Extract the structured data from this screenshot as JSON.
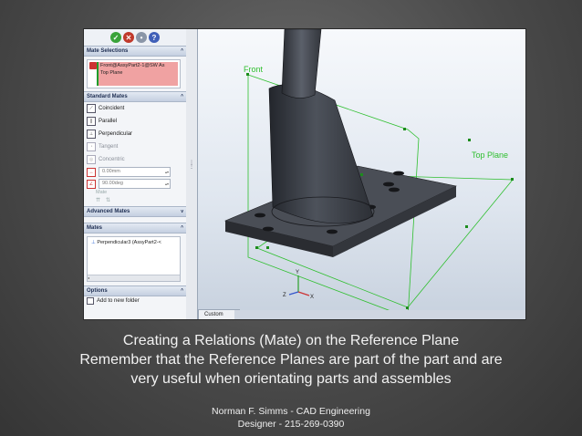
{
  "property_manager": {
    "mate_selections": {
      "title": "Mate Selections",
      "items": [
        "Front@AssyPart2-1@SW As",
        "Top Plane"
      ]
    },
    "standard_mates": {
      "title": "Standard Mates",
      "options": [
        {
          "label": "Coincident",
          "icon": "coincident-icon"
        },
        {
          "label": "Parallel",
          "icon": "parallel-icon"
        },
        {
          "label": "Perpendicular",
          "icon": "perpendicular-icon"
        },
        {
          "label": "Tangent",
          "icon": "tangent-icon"
        },
        {
          "label": "Concentric",
          "icon": "concentric-icon"
        }
      ],
      "distance_value": "0.00mm",
      "angle_value": "90.00deg",
      "alignment_label": "Mate"
    },
    "advanced_mates": {
      "title": "Advanced Mates"
    },
    "mates": {
      "title": "Mates",
      "list": [
        "Perpendicular3 (AssyPart2-<"
      ]
    },
    "options": {
      "title": "Options",
      "add_to_folder": "Add to new folder"
    }
  },
  "viewport": {
    "planes": {
      "front": "Front",
      "top": "Top Plane"
    },
    "axes": {
      "x": "X",
      "y": "Y",
      "z": "Z"
    },
    "tab_label": "Custom"
  },
  "caption": {
    "line1": "Creating a Relations  (Mate) on the Reference Plane",
    "line2": "Remember that the Reference Planes are part of the part and are",
    "line3": "very useful when orientating parts and assembles"
  },
  "credit": {
    "line1": "Norman F. Simms - CAD Engineering",
    "line2": "Designer - 215-269-0390"
  },
  "colors": {
    "plane_lines": "#2fbf2f",
    "selection_highlight": "#f0a2a2",
    "part_body": "#3a3d44"
  }
}
